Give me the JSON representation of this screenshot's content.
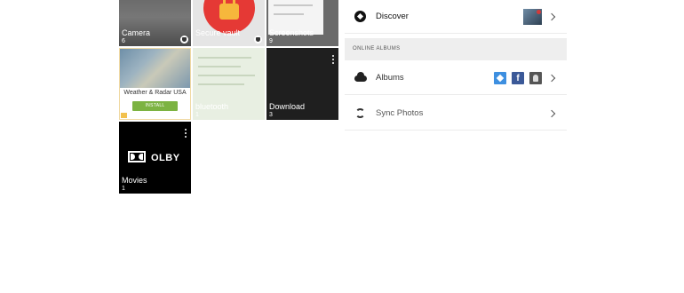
{
  "gallery": {
    "tiles": [
      {
        "label": "Camera",
        "count": "6"
      },
      {
        "label": "Secure vault",
        "count": ""
      },
      {
        "label": "Screenshots",
        "count": "9"
      },
      {
        "label": "",
        "count": ""
      },
      {
        "label": "bluetooth",
        "count": "1"
      },
      {
        "label": "Download",
        "count": "3"
      },
      {
        "label": "Movies",
        "count": "1"
      }
    ],
    "ad": {
      "app_name": "Weather & Radar USA",
      "install_label": "INSTALL"
    },
    "dolby_text": "OLBY"
  },
  "menu": {
    "discover_label": "Discover",
    "section_header": "ONLINE ALBUMS",
    "albums_label": "Albums",
    "albums_facebook_glyph": "f",
    "sync_label": "Sync Photos"
  },
  "icons": [
    "discover-icon",
    "cloud-icon",
    "sync-icon",
    "dropbox-icon",
    "facebook-icon",
    "contacts-icon",
    "lock-icon",
    "more-vert-icon",
    "chevron-right-icon"
  ],
  "colors": {
    "vault_red": "#e53935",
    "install_green": "#7cb342",
    "dropbox_blue": "#3d8fe0",
    "facebook_blue": "#3b5998"
  }
}
